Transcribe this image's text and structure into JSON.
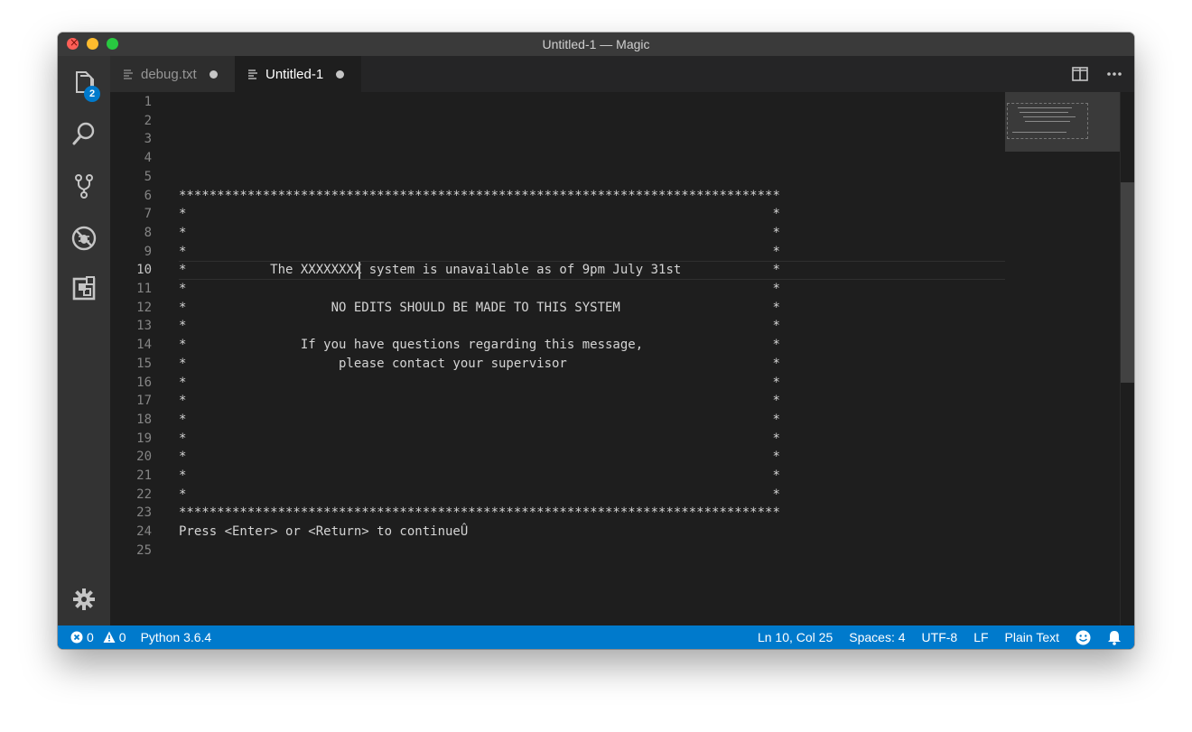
{
  "window": {
    "title": "Untitled-1 — Magic"
  },
  "activity": {
    "explorer_badge": "2",
    "icons": [
      "files-icon",
      "search-icon",
      "source-control-icon",
      "debug-icon",
      "extensions-icon",
      "gear-icon"
    ]
  },
  "tabs": [
    {
      "label": "debug.txt",
      "active": false,
      "modified": true
    },
    {
      "label": "Untitled-1",
      "active": true,
      "modified": true
    }
  ],
  "editor": {
    "line_numbers": [
      "1",
      "2",
      "3",
      "4",
      "5",
      "6",
      "7",
      "8",
      "9",
      "10",
      "11",
      "12",
      "13",
      "14",
      "15",
      "16",
      "17",
      "18",
      "19",
      "20",
      "21",
      "22",
      "23",
      "24",
      "25"
    ],
    "active_line": 10,
    "lines": [
      "",
      "",
      "",
      "",
      "",
      "*******************************************************************************",
      "*                                                                             *",
      "*                                                                             *",
      "*                                                                             *",
      "*           The XXXXXXXX system is unavailable as of 9pm July 31st            *",
      "*                                                                             *",
      "*                   NO EDITS SHOULD BE MADE TO THIS SYSTEM                    *",
      "*                                                                             *",
      "*               If you have questions regarding this message,                 *",
      "*                    please contact your supervisor                           *",
      "*                                                                             *",
      "*                                                                             *",
      "*                                                                             *",
      "*                                                                             *",
      "*                                                                             *",
      "*                                                                             *",
      "*                                                                             *",
      "*******************************************************************************",
      "Press <Enter> or <Return> to continueÛ",
      ""
    ]
  },
  "status": {
    "errors": "0",
    "warnings": "0",
    "interpreter": "Python 3.6.4",
    "position": "Ln 10, Col 25",
    "spaces": "Spaces: 4",
    "encoding": "UTF-8",
    "eol": "LF",
    "language": "Plain Text"
  },
  "colors": {
    "statusbar": "#007acc",
    "editor_bg": "#1e1e1e",
    "activitybar": "#333333",
    "tabbar": "#252526"
  }
}
